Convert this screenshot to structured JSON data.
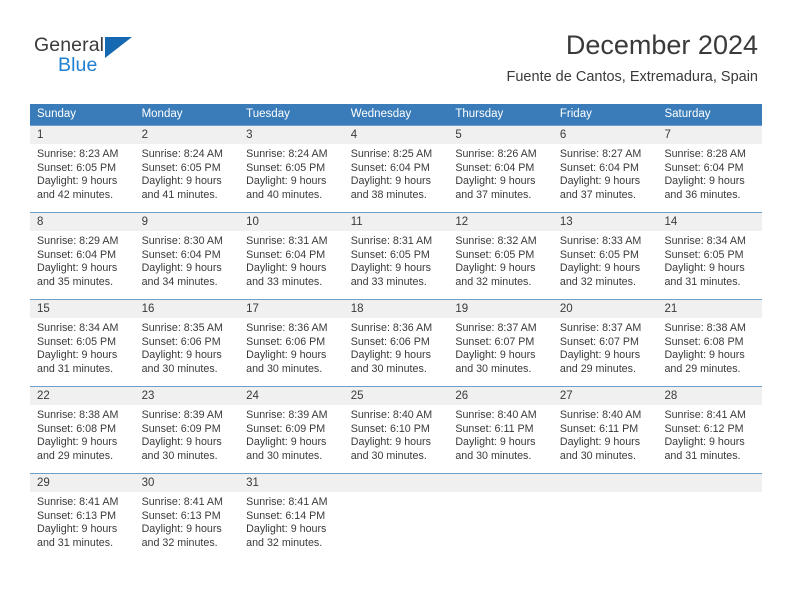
{
  "brand": {
    "name_top": "General",
    "name_bottom": "Blue",
    "accent_color": "#1f7fd0",
    "triangle_color": "#1668b0"
  },
  "header": {
    "title": "December 2024",
    "subtitle": "Fuente de Cantos, Extremadura, Spain"
  },
  "colors": {
    "weekday_header_bg": "#3a7cb9",
    "weekday_header_text": "#ffffff",
    "day_number_bg": "#f0f0f0",
    "week_border": "#6f9fc8",
    "text": "#3a3a3a"
  },
  "weekdays": [
    "Sunday",
    "Monday",
    "Tuesday",
    "Wednesday",
    "Thursday",
    "Friday",
    "Saturday"
  ],
  "weeks": [
    [
      {
        "day": "1",
        "sunrise": "Sunrise: 8:23 AM",
        "sunset": "Sunset: 6:05 PM",
        "daylight1": "Daylight: 9 hours",
        "daylight2": "and 42 minutes."
      },
      {
        "day": "2",
        "sunrise": "Sunrise: 8:24 AM",
        "sunset": "Sunset: 6:05 PM",
        "daylight1": "Daylight: 9 hours",
        "daylight2": "and 41 minutes."
      },
      {
        "day": "3",
        "sunrise": "Sunrise: 8:24 AM",
        "sunset": "Sunset: 6:05 PM",
        "daylight1": "Daylight: 9 hours",
        "daylight2": "and 40 minutes."
      },
      {
        "day": "4",
        "sunrise": "Sunrise: 8:25 AM",
        "sunset": "Sunset: 6:04 PM",
        "daylight1": "Daylight: 9 hours",
        "daylight2": "and 38 minutes."
      },
      {
        "day": "5",
        "sunrise": "Sunrise: 8:26 AM",
        "sunset": "Sunset: 6:04 PM",
        "daylight1": "Daylight: 9 hours",
        "daylight2": "and 37 minutes."
      },
      {
        "day": "6",
        "sunrise": "Sunrise: 8:27 AM",
        "sunset": "Sunset: 6:04 PM",
        "daylight1": "Daylight: 9 hours",
        "daylight2": "and 37 minutes."
      },
      {
        "day": "7",
        "sunrise": "Sunrise: 8:28 AM",
        "sunset": "Sunset: 6:04 PM",
        "daylight1": "Daylight: 9 hours",
        "daylight2": "and 36 minutes."
      }
    ],
    [
      {
        "day": "8",
        "sunrise": "Sunrise: 8:29 AM",
        "sunset": "Sunset: 6:04 PM",
        "daylight1": "Daylight: 9 hours",
        "daylight2": "and 35 minutes."
      },
      {
        "day": "9",
        "sunrise": "Sunrise: 8:30 AM",
        "sunset": "Sunset: 6:04 PM",
        "daylight1": "Daylight: 9 hours",
        "daylight2": "and 34 minutes."
      },
      {
        "day": "10",
        "sunrise": "Sunrise: 8:31 AM",
        "sunset": "Sunset: 6:04 PM",
        "daylight1": "Daylight: 9 hours",
        "daylight2": "and 33 minutes."
      },
      {
        "day": "11",
        "sunrise": "Sunrise: 8:31 AM",
        "sunset": "Sunset: 6:05 PM",
        "daylight1": "Daylight: 9 hours",
        "daylight2": "and 33 minutes."
      },
      {
        "day": "12",
        "sunrise": "Sunrise: 8:32 AM",
        "sunset": "Sunset: 6:05 PM",
        "daylight1": "Daylight: 9 hours",
        "daylight2": "and 32 minutes."
      },
      {
        "day": "13",
        "sunrise": "Sunrise: 8:33 AM",
        "sunset": "Sunset: 6:05 PM",
        "daylight1": "Daylight: 9 hours",
        "daylight2": "and 32 minutes."
      },
      {
        "day": "14",
        "sunrise": "Sunrise: 8:34 AM",
        "sunset": "Sunset: 6:05 PM",
        "daylight1": "Daylight: 9 hours",
        "daylight2": "and 31 minutes."
      }
    ],
    [
      {
        "day": "15",
        "sunrise": "Sunrise: 8:34 AM",
        "sunset": "Sunset: 6:05 PM",
        "daylight1": "Daylight: 9 hours",
        "daylight2": "and 31 minutes."
      },
      {
        "day": "16",
        "sunrise": "Sunrise: 8:35 AM",
        "sunset": "Sunset: 6:06 PM",
        "daylight1": "Daylight: 9 hours",
        "daylight2": "and 30 minutes."
      },
      {
        "day": "17",
        "sunrise": "Sunrise: 8:36 AM",
        "sunset": "Sunset: 6:06 PM",
        "daylight1": "Daylight: 9 hours",
        "daylight2": "and 30 minutes."
      },
      {
        "day": "18",
        "sunrise": "Sunrise: 8:36 AM",
        "sunset": "Sunset: 6:06 PM",
        "daylight1": "Daylight: 9 hours",
        "daylight2": "and 30 minutes."
      },
      {
        "day": "19",
        "sunrise": "Sunrise: 8:37 AM",
        "sunset": "Sunset: 6:07 PM",
        "daylight1": "Daylight: 9 hours",
        "daylight2": "and 30 minutes."
      },
      {
        "day": "20",
        "sunrise": "Sunrise: 8:37 AM",
        "sunset": "Sunset: 6:07 PM",
        "daylight1": "Daylight: 9 hours",
        "daylight2": "and 29 minutes."
      },
      {
        "day": "21",
        "sunrise": "Sunrise: 8:38 AM",
        "sunset": "Sunset: 6:08 PM",
        "daylight1": "Daylight: 9 hours",
        "daylight2": "and 29 minutes."
      }
    ],
    [
      {
        "day": "22",
        "sunrise": "Sunrise: 8:38 AM",
        "sunset": "Sunset: 6:08 PM",
        "daylight1": "Daylight: 9 hours",
        "daylight2": "and 29 minutes."
      },
      {
        "day": "23",
        "sunrise": "Sunrise: 8:39 AM",
        "sunset": "Sunset: 6:09 PM",
        "daylight1": "Daylight: 9 hours",
        "daylight2": "and 30 minutes."
      },
      {
        "day": "24",
        "sunrise": "Sunrise: 8:39 AM",
        "sunset": "Sunset: 6:09 PM",
        "daylight1": "Daylight: 9 hours",
        "daylight2": "and 30 minutes."
      },
      {
        "day": "25",
        "sunrise": "Sunrise: 8:40 AM",
        "sunset": "Sunset: 6:10 PM",
        "daylight1": "Daylight: 9 hours",
        "daylight2": "and 30 minutes."
      },
      {
        "day": "26",
        "sunrise": "Sunrise: 8:40 AM",
        "sunset": "Sunset: 6:11 PM",
        "daylight1": "Daylight: 9 hours",
        "daylight2": "and 30 minutes."
      },
      {
        "day": "27",
        "sunrise": "Sunrise: 8:40 AM",
        "sunset": "Sunset: 6:11 PM",
        "daylight1": "Daylight: 9 hours",
        "daylight2": "and 30 minutes."
      },
      {
        "day": "28",
        "sunrise": "Sunrise: 8:41 AM",
        "sunset": "Sunset: 6:12 PM",
        "daylight1": "Daylight: 9 hours",
        "daylight2": "and 31 minutes."
      }
    ],
    [
      {
        "day": "29",
        "sunrise": "Sunrise: 8:41 AM",
        "sunset": "Sunset: 6:13 PM",
        "daylight1": "Daylight: 9 hours",
        "daylight2": "and 31 minutes."
      },
      {
        "day": "30",
        "sunrise": "Sunrise: 8:41 AM",
        "sunset": "Sunset: 6:13 PM",
        "daylight1": "Daylight: 9 hours",
        "daylight2": "and 32 minutes."
      },
      {
        "day": "31",
        "sunrise": "Sunrise: 8:41 AM",
        "sunset": "Sunset: 6:14 PM",
        "daylight1": "Daylight: 9 hours",
        "daylight2": "and 32 minutes."
      },
      {
        "day": "",
        "sunrise": "",
        "sunset": "",
        "daylight1": "",
        "daylight2": ""
      },
      {
        "day": "",
        "sunrise": "",
        "sunset": "",
        "daylight1": "",
        "daylight2": ""
      },
      {
        "day": "",
        "sunrise": "",
        "sunset": "",
        "daylight1": "",
        "daylight2": ""
      },
      {
        "day": "",
        "sunrise": "",
        "sunset": "",
        "daylight1": "",
        "daylight2": ""
      }
    ]
  ]
}
